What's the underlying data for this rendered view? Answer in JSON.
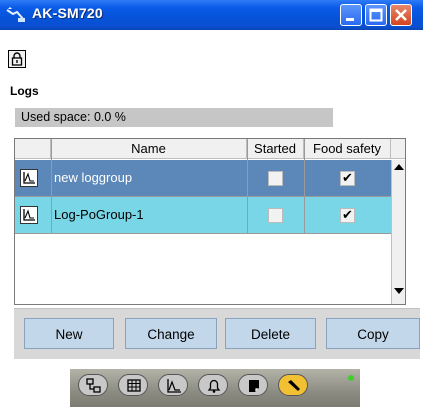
{
  "window": {
    "title": "AK-SM720",
    "title_bar_color": "#0a5be8",
    "controls": [
      "minimize-icon",
      "maximize-icon",
      "close-icon"
    ]
  },
  "lock": {
    "icon": "lock-icon"
  },
  "logs": {
    "title": "Logs",
    "used_space": "Used space: 0.0 %",
    "columns": [
      "Name",
      "Started",
      "Food safety"
    ],
    "rows": [
      {
        "name": "new loggroup",
        "started": false,
        "food_safety": true,
        "selected": true,
        "color": "#5b87b9"
      },
      {
        "name": "Log-PoGroup-1",
        "started": false,
        "food_safety": true,
        "selected": false,
        "color": "#78d6e6"
      }
    ]
  },
  "actions": {
    "new": "New",
    "change": "Change",
    "delete": "Delete",
    "copy": "Copy"
  },
  "toolbar": {
    "items": [
      "hierarchy-icon",
      "grid-icon",
      "graph-icon",
      "bell-icon",
      "note-icon",
      "wrench-icon"
    ],
    "active": "wrench-icon",
    "active_color": "#f1c033",
    "status_led_color": "#3fcf2a"
  }
}
